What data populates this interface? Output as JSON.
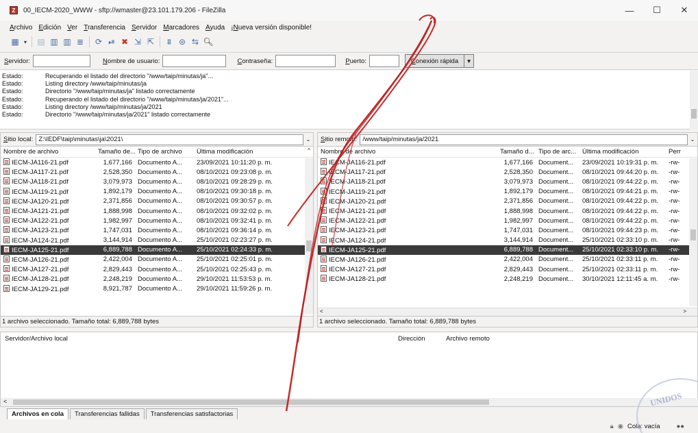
{
  "window": {
    "title": "00_IECM-2020_WWW - sftp://wmaster@23.101.179.206 - FileZilla",
    "app_icon": "filezilla-icon",
    "controls": [
      "—",
      "☐",
      "✕"
    ]
  },
  "menu": [
    "Archivo",
    "Edición",
    "Ver",
    "Transferencia",
    "Servidor",
    "Marcadores",
    "Ayuda",
    "¡Nueva versión disponible!"
  ],
  "quickconnect": {
    "host_label": "Servidor:",
    "user_label": "Nombre de usuario:",
    "pass_label": "Contraseña:",
    "port_label": "Puerto:",
    "button": "Conexión rápida",
    "host_value": "",
    "user_value": "",
    "pass_value": "",
    "port_value": ""
  },
  "log": [
    {
      "k": "Estado:",
      "v": "Recuperando el listado del directorio \"/www/taip/minutas/ja\"..."
    },
    {
      "k": "Estado:",
      "v": "Listing directory /www/taip/minutas/ja"
    },
    {
      "k": "Estado:",
      "v": "Directorio \"/www/taip/minutas/ja\" listado correctamente"
    },
    {
      "k": "Estado:",
      "v": "Recuperando el listado del directorio \"/www/taip/minutas/ja/2021\"..."
    },
    {
      "k": "Estado:",
      "v": "Listing directory /www/taip/minutas/ja/2021"
    },
    {
      "k": "Estado:",
      "v": "Directorio \"/www/taip/minutas/ja/2021\" listado correctamente"
    }
  ],
  "local": {
    "site_label": "Sitio local:",
    "path": "Z:\\IEDF\\taip\\minutas\\ja\\2021\\",
    "columns": [
      "Nombre de archivo",
      "Tamaño de...",
      "Tipo de archivo",
      "Última modificación"
    ],
    "rows": [
      [
        "IECM-JA116-21.pdf",
        "1,677,166",
        "Documento A...",
        "23/09/2021 10:11:20 p. m."
      ],
      [
        "IECM-JA117-21.pdf",
        "2,528,350",
        "Documento A...",
        "08/10/2021 09:23:08 p. m."
      ],
      [
        "IECM-JA118-21.pdf",
        "3,079,973",
        "Documento A...",
        "08/10/2021 09:28:29 p. m."
      ],
      [
        "IECM-JA119-21.pdf",
        "1,892,179",
        "Documento A...",
        "08/10/2021 09:30:18 p. m."
      ],
      [
        "IECM-JA120-21.pdf",
        "2,371,856",
        "Documento A...",
        "08/10/2021 09:30:57 p. m."
      ],
      [
        "IECM-JA121-21.pdf",
        "1,888,998",
        "Documento A...",
        "08/10/2021 09:32:02 p. m."
      ],
      [
        "IECM-JA122-21.pdf",
        "1,982,997",
        "Documento A...",
        "08/10/2021 09:32:41 p. m."
      ],
      [
        "IECM-JA123-21.pdf",
        "1,747,031",
        "Documento A...",
        "08/10/2021 09:36:14 p. m."
      ],
      [
        "IECM-JA124-21.pdf",
        "3,144,914",
        "Documento A...",
        "25/10/2021 02:23:27 p. m."
      ],
      [
        "IECM-JA125-21.pdf",
        "6,889,788",
        "Documento A...",
        "25/10/2021 02:24:33 p. m."
      ],
      [
        "IECM-JA126-21.pdf",
        "2,422,004",
        "Documento A...",
        "25/10/2021 02:25:01 p. m."
      ],
      [
        "IECM-JA127-21.pdf",
        "2,829,443",
        "Documento A...",
        "25/10/2021 02:25:43 p. m."
      ],
      [
        "IECM-JA128-21.pdf",
        "2,248,219",
        "Documento A...",
        "29/10/2021 11:53:53 p. m."
      ],
      [
        "IECM-JA129-21.pdf",
        "8,921,787",
        "Documento A...",
        "29/10/2021 11:59:26 p. m."
      ]
    ],
    "status": "1 archivo seleccionado. Tamaño total: 6,889,788 bytes"
  },
  "remote": {
    "site_label": "Sitio remoto:",
    "path": "/www/taip/minutas/ja/2021",
    "columns": [
      "Nombre de archivo",
      "Tamaño d...",
      "Tipo de arc...",
      "Última modificación",
      "Perr"
    ],
    "rows": [
      [
        "IECM-JA116-21.pdf",
        "1,677,166",
        "Document...",
        "23/09/2021 10:19:31 p. m.",
        "-rw-"
      ],
      [
        "IECM-JA117-21.pdf",
        "2,528,350",
        "Document...",
        "08/10/2021 09:44:20 p. m.",
        "-rw-"
      ],
      [
        "IECM-JA118-21.pdf",
        "3,079,973",
        "Document...",
        "08/10/2021 09:44:22 p. m.",
        "-rw-"
      ],
      [
        "IECM-JA119-21.pdf",
        "1,892,179",
        "Document...",
        "08/10/2021 09:44:21 p. m.",
        "-rw-"
      ],
      [
        "IECM-JA120-21.pdf",
        "2,371,856",
        "Document...",
        "08/10/2021 09:44:22 p. m.",
        "-rw-"
      ],
      [
        "IECM-JA121-21.pdf",
        "1,888,998",
        "Document...",
        "08/10/2021 09:44:22 p. m.",
        "-rw-"
      ],
      [
        "IECM-JA122-21.pdf",
        "1,982,997",
        "Document...",
        "08/10/2021 09:44:22 p. m.",
        "-rw-"
      ],
      [
        "IECM-JA123-21.pdf",
        "1,747,031",
        "Document...",
        "08/10/2021 09:44:23 p. m.",
        "-rw-"
      ],
      [
        "IECM-JA124-21.pdf",
        "3,144,914",
        "Document...",
        "25/10/2021 02:33:10 p. m.",
        "-rw-"
      ],
      [
        "IECM-JA125-21.pdf",
        "6,889,788",
        "Document...",
        "25/10/2021 02:33:10 p. m.",
        "-rw-"
      ],
      [
        "IECM-JA126-21.pdf",
        "2,422,004",
        "Document...",
        "25/10/2021 02:33:11 p. m.",
        "-rw-"
      ],
      [
        "IECM-JA127-21.pdf",
        "2,829,443",
        "Document...",
        "25/10/2021 02:33:11 p. m.",
        "-rw-"
      ],
      [
        "IECM-JA128-21.pdf",
        "2,248,219",
        "Document...",
        "30/10/2021 12:11:45 a. m.",
        "-rw-"
      ]
    ],
    "selected_index": 9,
    "status": "1 archivo seleccionado. Tamaño total: 6,889,788 bytes"
  },
  "queue": {
    "col_server": "Servidor/Archivo local",
    "col_direction": "Dirección",
    "col_remote": "Archivo remoto"
  },
  "tabs": [
    "Archivos en cola",
    "Transferencias fallidas",
    "Transferencias satisfactorias"
  ],
  "footer": {
    "queue_status": "Cola: vacía"
  },
  "seal_text": "UNIDOS",
  "colors": {
    "selection": "#3a3a3a",
    "signature": "#c42a2a"
  }
}
